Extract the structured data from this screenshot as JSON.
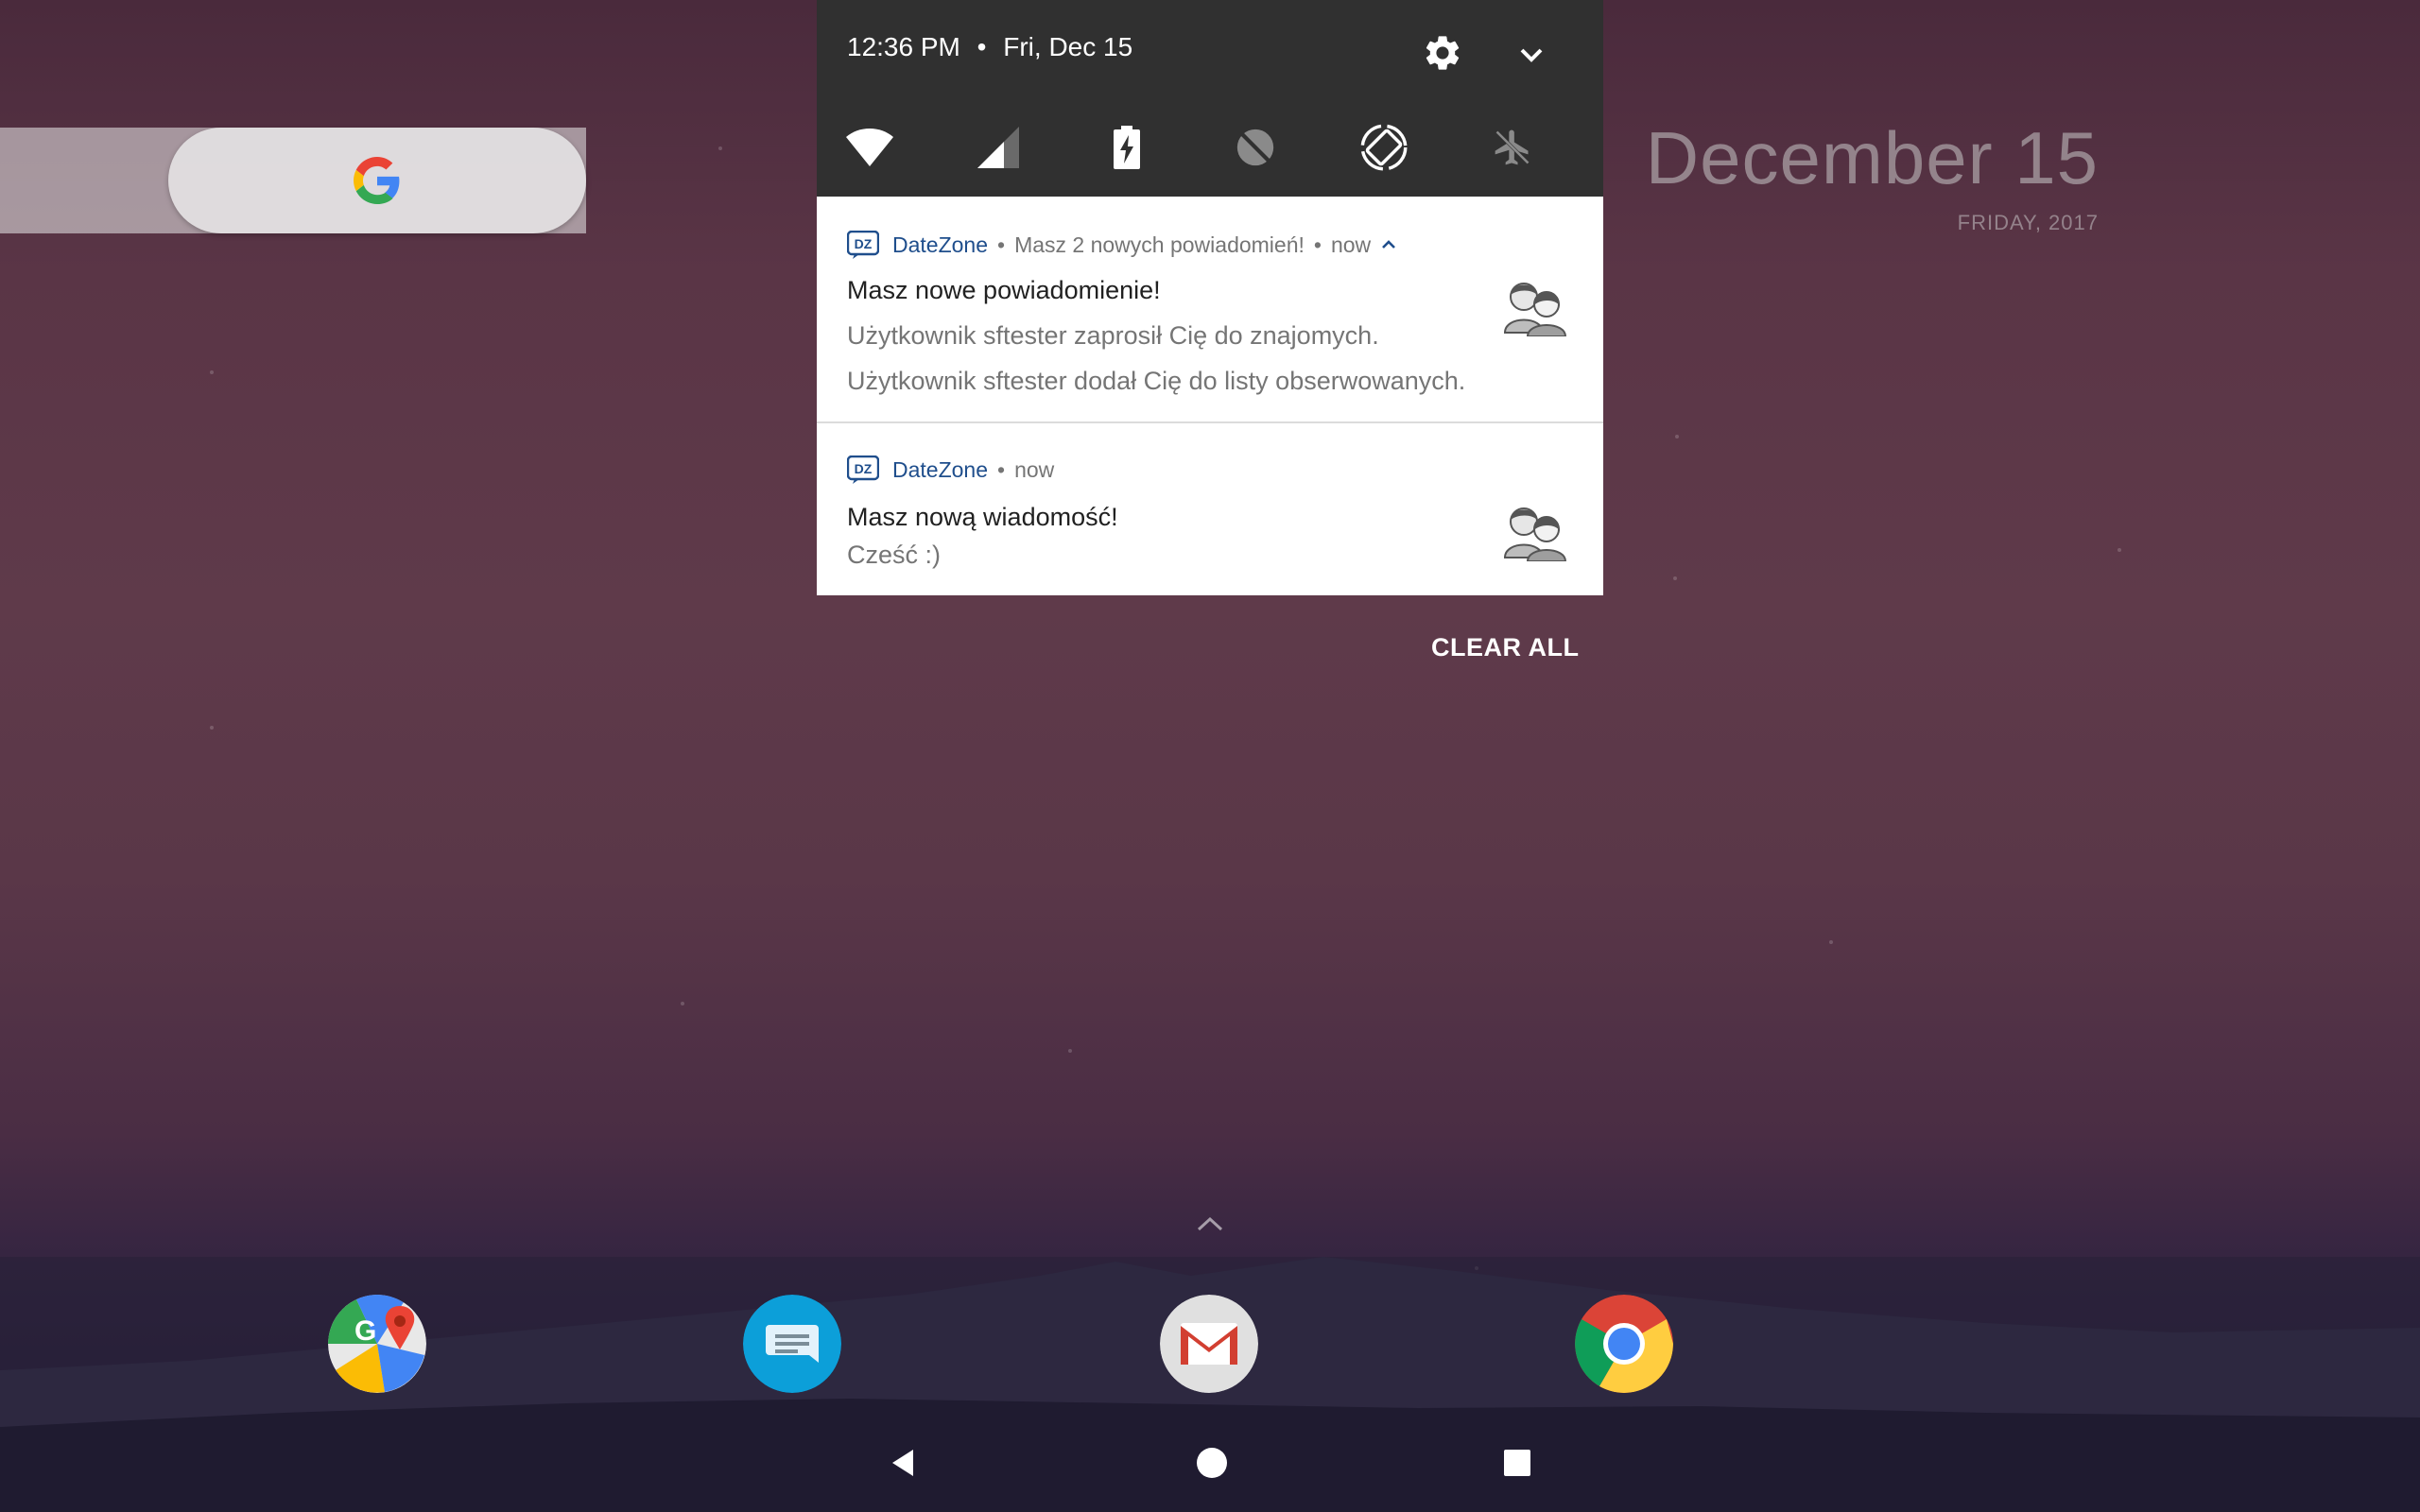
{
  "status": {
    "time": "12:36 PM",
    "separator": "•",
    "date": "Fri, Dec 15"
  },
  "quick_settings": {
    "icons": [
      "settings-icon",
      "expand-icon",
      "wifi-icon",
      "cellular-signal-icon",
      "battery-charging-icon",
      "location-off-icon",
      "auto-rotate-icon",
      "airplane-mode-icon"
    ]
  },
  "notifications": [
    {
      "app": "DateZone",
      "summary": "Masz 2 nowych powiadomień!",
      "time": "now",
      "title": "Masz nowe powiadomienie!",
      "lines": [
        "Użytkownik sftester zaprosił Cię do znajomych.",
        "Użytkownik sftester dodał Cię do listy obserwowanych."
      ]
    },
    {
      "app": "DateZone",
      "time": "now",
      "title": "Masz nową wiadomość!",
      "lines": [
        "Cześć :)"
      ]
    }
  ],
  "clear_all": "CLEAR ALL",
  "date_widget": {
    "main": "December 15",
    "sub": "FRIDAY, 2017"
  },
  "app_icon_badge": "DZ",
  "dock": [
    "Maps",
    "Messages",
    "Gmail",
    "Chrome"
  ],
  "colors": {
    "shade_bg": "#303030",
    "app_name": "#1f4e8c"
  }
}
